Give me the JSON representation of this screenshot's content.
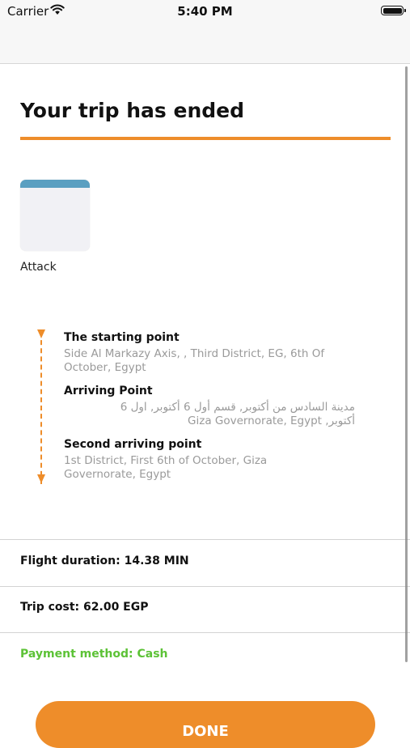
{
  "status_bar": {
    "carrier": "Carrier",
    "time": "5:40 PM"
  },
  "page": {
    "title": "Your trip has ended",
    "accent_color": "#ee8d2a",
    "success_color": "#5cc236"
  },
  "vehicle": {
    "label": "Attack"
  },
  "route": {
    "stops": [
      {
        "title": "The starting point",
        "address": "Side Al Markazy Axis, , Third District, EG, 6th Of\nOctober, Egypt"
      },
      {
        "title": "Arriving Point",
        "address": "مدينة السادس من أكتوبر, قسم أول 6 أكتوبر, اول 6\nأكتوبر, Giza Governorate, Egypt"
      },
      {
        "title": "Second arriving point",
        "address": "1st District, First 6th of October, Giza\nGovernorate, Egypt"
      }
    ]
  },
  "summary": {
    "flight_duration": "Flight duration: 14.38 MIN",
    "trip_cost": "Trip cost: 62.00 EGP",
    "payment_method": "Payment method: Cash"
  },
  "actions": {
    "done_label": "DONE"
  }
}
